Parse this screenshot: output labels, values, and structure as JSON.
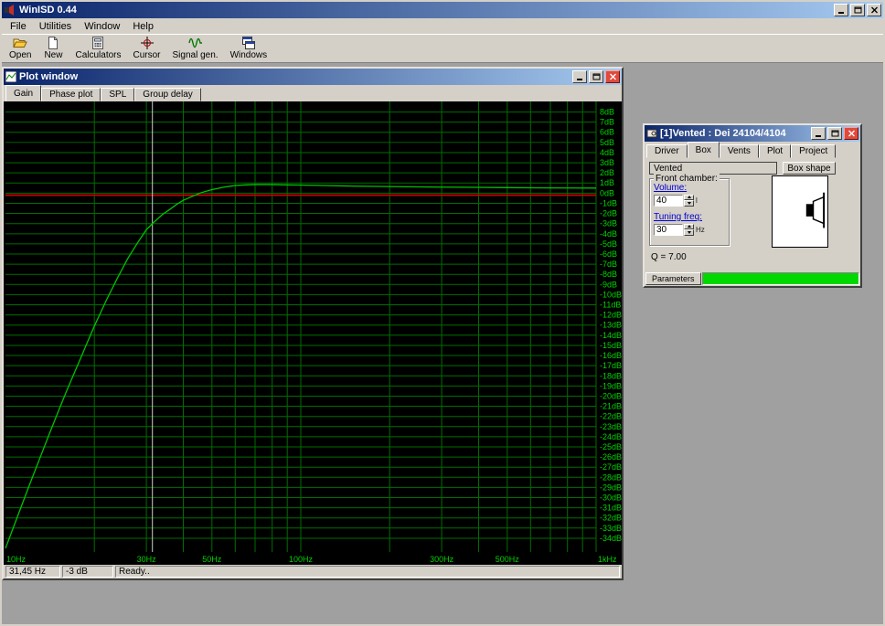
{
  "main_window": {
    "title": "WinISD 0.44",
    "menu_items": [
      "File",
      "Utilities",
      "Window",
      "Help"
    ],
    "toolbar": [
      {
        "label": "Open",
        "icon": "open-folder-icon"
      },
      {
        "label": "New",
        "icon": "new-document-icon"
      },
      {
        "label": "Calculators",
        "icon": "calculator-icon"
      },
      {
        "label": "Cursor",
        "icon": "cursor-crosshair-icon"
      },
      {
        "label": "Signal gen.",
        "icon": "sine-wave-icon"
      },
      {
        "label": "Windows",
        "icon": "cascade-windows-icon"
      }
    ]
  },
  "plot_window": {
    "title": "Plot window",
    "tabs": [
      {
        "label": "Gain",
        "active": true
      },
      {
        "label": "Phase plot",
        "active": false
      },
      {
        "label": "SPL",
        "active": false
      },
      {
        "label": "Group delay",
        "active": false
      }
    ],
    "status": [
      "31,45 Hz",
      "-3 dB",
      "Ready.."
    ]
  },
  "chart_data": {
    "type": "line",
    "title": "Gain",
    "x_scale": "log",
    "xlim": [
      10,
      1000
    ],
    "ylim": [
      -35,
      8.5
    ],
    "grid": true,
    "x_ticks": [
      {
        "label": "10Hz",
        "value": 10
      },
      {
        "label": "30Hz",
        "value": 30
      },
      {
        "label": "50Hz",
        "value": 50
      },
      {
        "label": "100Hz",
        "value": 100
      },
      {
        "label": "300Hz",
        "value": 300
      },
      {
        "label": "500Hz",
        "value": 500
      },
      {
        "label": "1kHz",
        "value": 1000
      }
    ],
    "y_ticks": [
      "8dB",
      "7dB",
      "6dB",
      "5dB",
      "4dB",
      "3dB",
      "2dB",
      "1dB",
      "0dB",
      "-1dB",
      "-2dB",
      "-3dB",
      "-4dB",
      "-5dB",
      "-6dB",
      "-7dB",
      "-8dB",
      "-9dB",
      "-10dB",
      "-11dB",
      "-12dB",
      "-13dB",
      "-14dB",
      "-15dB",
      "-16dB",
      "-17dB",
      "-18dB",
      "-19dB",
      "-20dB",
      "-21dB",
      "-22dB",
      "-23dB",
      "-24dB",
      "-25dB",
      "-26dB",
      "-27dB",
      "-28dB",
      "-29dB",
      "-30dB",
      "-31dB",
      "-32dB",
      "-33dB",
      "-34dB"
    ],
    "reference_line": {
      "value": -0.2,
      "color": "#d40000"
    },
    "cursor": {
      "frequency": 31.45,
      "gain_db": -3
    },
    "series": [
      {
        "name": "vented-gain-response",
        "color": "#00c400",
        "points": [
          [
            10,
            -35
          ],
          [
            11,
            -31.8
          ],
          [
            12,
            -28.9
          ],
          [
            13,
            -26.3
          ],
          [
            14,
            -23.9
          ],
          [
            15,
            -21.7
          ],
          [
            16,
            -19.7
          ],
          [
            17,
            -17.9
          ],
          [
            18,
            -16.2
          ],
          [
            19,
            -14.6
          ],
          [
            20,
            -13.1
          ],
          [
            22,
            -10.5
          ],
          [
            24,
            -8.3
          ],
          [
            26,
            -6.4
          ],
          [
            28,
            -4.9
          ],
          [
            30,
            -3.6
          ],
          [
            31.45,
            -3.0
          ],
          [
            34,
            -2.1
          ],
          [
            36,
            -1.6
          ],
          [
            38,
            -1.1
          ],
          [
            40,
            -0.7
          ],
          [
            43,
            -0.3
          ],
          [
            46,
            0.05
          ],
          [
            50,
            0.35
          ],
          [
            55,
            0.6
          ],
          [
            60,
            0.75
          ],
          [
            65,
            0.82
          ],
          [
            70,
            0.85
          ],
          [
            80,
            0.85
          ],
          [
            90,
            0.82
          ],
          [
            100,
            0.8
          ],
          [
            120,
            0.75
          ],
          [
            150,
            0.7
          ],
          [
            200,
            0.65
          ],
          [
            250,
            0.62
          ],
          [
            300,
            0.6
          ],
          [
            400,
            0.57
          ],
          [
            500,
            0.55
          ],
          [
            700,
            0.52
          ],
          [
            1000,
            0.5
          ]
        ]
      }
    ],
    "colors": {
      "background": "#000000",
      "grid": "#006e00",
      "axis_labels": "#00d400",
      "cursor_line": "#cccccc"
    }
  },
  "vented_window": {
    "title": "[1]Vented : Dei 24104/4104",
    "tabs": [
      {
        "label": "Driver",
        "active": false
      },
      {
        "label": "Box",
        "active": true
      },
      {
        "label": "Vents",
        "active": false
      },
      {
        "label": "Plot",
        "active": false
      },
      {
        "label": "Project",
        "active": false
      }
    ],
    "box_type_value": "Vented",
    "box_shape_button": "Box shape",
    "front_chamber": {
      "legend": "Front chamber:",
      "volume_label": "Volume:",
      "volume_value": "40",
      "volume_unit": "l",
      "tuning_label": "Tuning freq:",
      "tuning_value": "30",
      "tuning_unit": "Hz"
    },
    "q_text": "Q = 7.00",
    "parameters_tab": "Parameters"
  },
  "colors": {
    "progress_bar": "#00d800",
    "titlebar_left": "#0a246a",
    "titlebar_right": "#a6caf0",
    "desktop": "#a0a0a0"
  }
}
